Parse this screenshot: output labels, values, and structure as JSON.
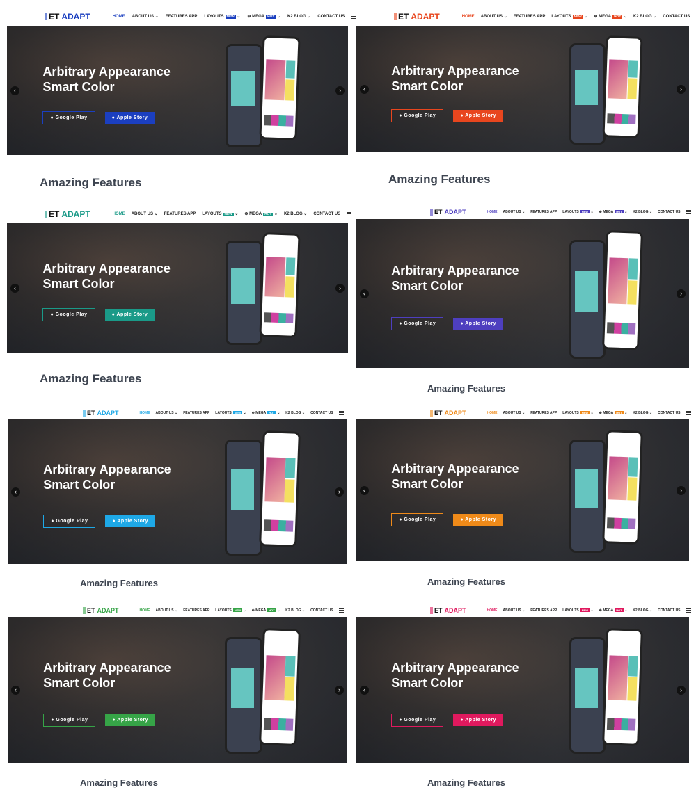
{
  "header": {
    "logo_prefix": "ET",
    "logo_brand": "ADAPT",
    "nav": [
      "HOME",
      "ABOUT US ⌄",
      "FEATURES APP",
      "LAYOUTS",
      "⊕ MEGA",
      "K2 BLOG ⌄",
      "CONTACT US"
    ],
    "badge_new": "NEW",
    "badge_hot": "HOT",
    "menu_icon": "hamburger-icon"
  },
  "hero": {
    "title_line1": "Arbitrary Appearance",
    "title_line2": "Smart Color",
    "google_play": "● Google Play",
    "apple_store": "● Apple Story",
    "prev": "‹",
    "next": "›"
  },
  "section_title": "Amazing Features",
  "variants": [
    {
      "accent": "#1b3fc0"
    },
    {
      "accent": "#e8461e"
    },
    {
      "accent": "#1a9a88"
    },
    {
      "accent": "#4e3fbf"
    },
    {
      "accent": "#1ea8e6"
    },
    {
      "accent": "#ef8a19"
    },
    {
      "accent": "#36a447"
    },
    {
      "accent": "#e0195e"
    }
  ]
}
